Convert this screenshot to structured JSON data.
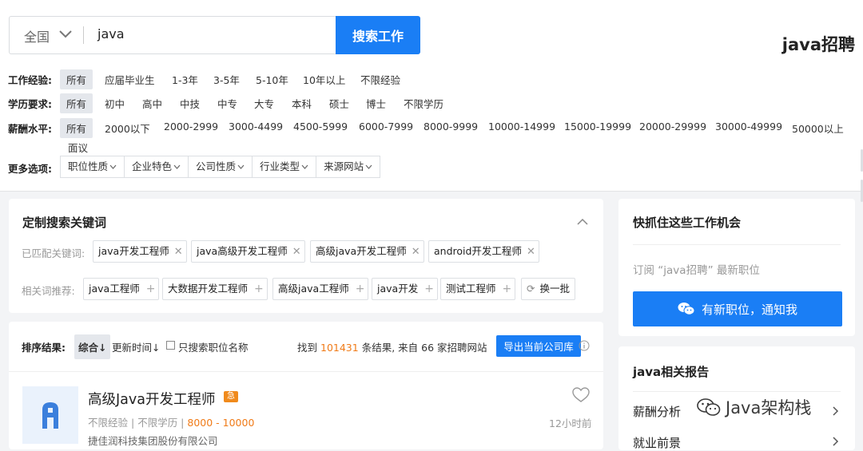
{
  "search": {
    "city": "全国",
    "keyword": "java",
    "button": "搜索工作",
    "page_title": "java招聘"
  },
  "filters": {
    "experience": {
      "label": "工作经验:",
      "options": [
        "所有",
        "应届毕业生",
        "1-3年",
        "3-5年",
        "5-10年",
        "10年以上",
        "不限经验"
      ]
    },
    "education": {
      "label": "学历要求:",
      "options": [
        "所有",
        "初中",
        "高中",
        "中技",
        "中专",
        "大专",
        "本科",
        "硕士",
        "博士",
        "不限学历"
      ]
    },
    "salary": {
      "label": "薪酬水平:",
      "options": [
        "所有",
        "2000以下",
        "2000-2999",
        "3000-4499",
        "4500-5999",
        "6000-7999",
        "8000-9999",
        "10000-14999",
        "15000-19999",
        "20000-29999",
        "30000-49999",
        "50000以上",
        "面议"
      ]
    },
    "more": {
      "label": "更多选项:",
      "options": [
        "职位性质",
        "企业特色",
        "公司性质",
        "行业类型",
        "来源网站"
      ]
    }
  },
  "keywords_card": {
    "title": "定制搜索关键词",
    "matched_label": "已匹配关键词:",
    "matched": [
      "java开发工程师",
      "java高级开发工程师",
      "高级java开发工程师",
      "android开发工程师"
    ],
    "related_label": "相关词推荐:",
    "related": [
      "java工程师",
      "大数据开发工程师",
      "高级java工程师",
      "java开发",
      "测试工程师"
    ],
    "refresh": "换一批"
  },
  "results": {
    "sort_label": "排序结果:",
    "sort_options": [
      "综合↓",
      "更新时间↓"
    ],
    "only_title": "只搜索职位名称",
    "summary": {
      "prefix": "找到",
      "count": "101431",
      "middle": "条结果, 来自",
      "sites": "66",
      "suffix": "家招聘网站"
    },
    "export": "导出当前公司库"
  },
  "job": {
    "title": "高级Java开发工程师",
    "hot": "急",
    "experience": "不限经验",
    "education": "不限学历",
    "salary": "8000 - 10000",
    "company": "捷佳润科技集团股份有限公司",
    "time": "12小时前"
  },
  "opportunity": {
    "title": "快抓住这些工作机会",
    "subscribe": "订阅 “java招聘” 最新职位",
    "notify": "有新职位，通知我"
  },
  "reports": {
    "title": "java相关报告",
    "items": [
      "薪酬分析",
      "就业前景"
    ]
  },
  "watermark": "Java架构栈",
  "colors": {
    "accent": "#1a7ef5",
    "salary": "#f07b18",
    "hot": "#f08a1c"
  }
}
